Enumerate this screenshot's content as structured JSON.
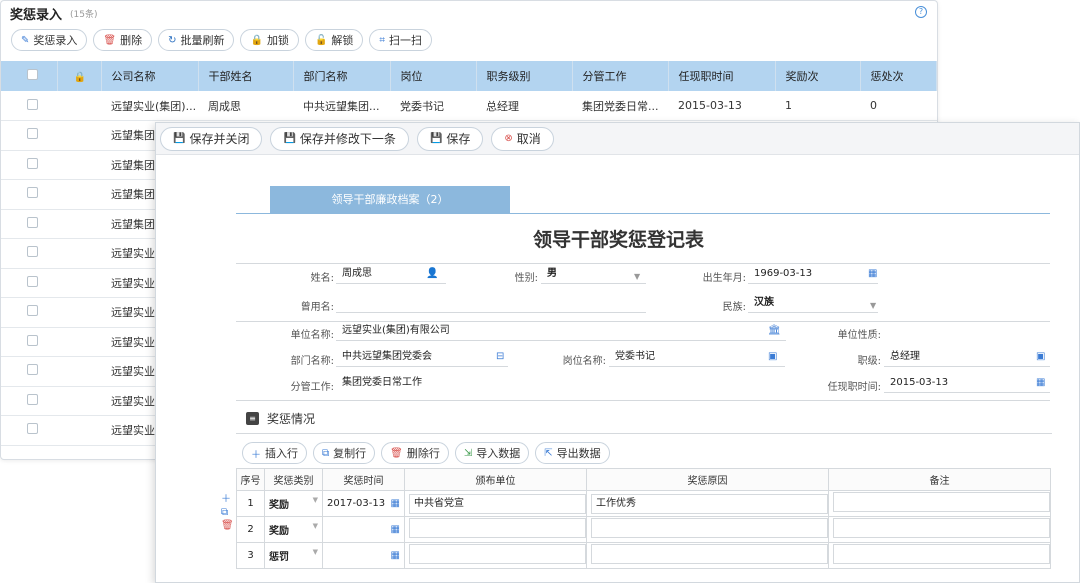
{
  "list_window": {
    "title": "奖惩录入",
    "count": "(15条)",
    "help": "?",
    "toolbar": [
      {
        "label": "奖惩录入",
        "icon": "edit-icon"
      },
      {
        "label": "删除",
        "icon": "trash-icon"
      },
      {
        "label": "批量刷新",
        "icon": "refresh-icon"
      },
      {
        "label": "加锁",
        "icon": "lock-icon"
      },
      {
        "label": "解锁",
        "icon": "unlock-icon"
      },
      {
        "label": "扫一扫",
        "icon": "scan-icon"
      }
    ],
    "columns": [
      "公司名称",
      "干部姓名",
      "部门名称",
      "岗位",
      "职务级别",
      "分管工作",
      "任现职时间",
      "奖励次",
      "惩处次"
    ],
    "first_row": [
      "远望实业(集团)...",
      "周成思",
      "中共远望集团...",
      "党委书记",
      "总经理",
      "集团党委日常...",
      "2015-03-13",
      "1",
      "0"
    ],
    "other_rows": [
      "远望集团财",
      "远望集团财",
      "远望集团财",
      "远望集团财",
      "远望实业(集",
      "远望实业(集",
      "远望实业(集",
      "远望实业(集",
      "远望实业(集",
      "远望实业(集",
      "远望实业(集"
    ]
  },
  "form_window": {
    "toolbar": [
      {
        "label": "保存并关闭",
        "icon": "save-icon"
      },
      {
        "label": "保存并修改下一条",
        "icon": "save-icon"
      },
      {
        "label": "保存",
        "icon": "save-icon"
      },
      {
        "label": "取消",
        "icon": "cancel-icon"
      }
    ],
    "tab": "领导干部廉政档案（2）",
    "title": "领导干部奖惩登记表",
    "fields": {
      "name_label": "姓名:",
      "name": "周成思",
      "gender_label": "性别:",
      "gender": "男",
      "birth_label": "出生年月:",
      "birth": "1969-03-13",
      "alias_label": "曾用名:",
      "alias": "",
      "ethnic_label": "民族:",
      "ethnic": "汉族",
      "unit_label": "单位名称:",
      "unit": "远望实业(集团)有限公司",
      "unit_type_label": "单位性质:",
      "unit_type": "",
      "dept_label": "部门名称:",
      "dept": "中共远望集团党委会",
      "post_label": "岗位名称:",
      "post": "党委书记",
      "rank_label": "职级:",
      "rank": "总经理",
      "duty_label": "分管工作:",
      "duty": "集团党委日常工作",
      "start_label": "任现职时间:",
      "start": "2015-03-13"
    },
    "section": "奖惩情况",
    "detail_toolbar": [
      {
        "label": "插入行",
        "icon": "plus-icon"
      },
      {
        "label": "复制行",
        "icon": "copy-icon"
      },
      {
        "label": "删除行",
        "icon": "trash-icon"
      },
      {
        "label": "导入数据",
        "icon": "import-icon"
      },
      {
        "label": "导出数据",
        "icon": "export-icon"
      }
    ],
    "detail_columns": [
      "序号",
      "奖惩类别",
      "奖惩时间",
      "颁布单位",
      "奖惩原因",
      "备注"
    ],
    "detail_rows": [
      {
        "seq": "1",
        "type": "奖励",
        "date": "2017-03-13",
        "issuer": "中共省党宣",
        "reason": "工作优秀",
        "note": ""
      },
      {
        "seq": "2",
        "type": "奖励",
        "date": "",
        "issuer": "",
        "reason": "",
        "note": ""
      },
      {
        "seq": "3",
        "type": "惩罚",
        "date": "",
        "issuer": "",
        "reason": "",
        "note": ""
      }
    ]
  },
  "colors": {
    "header_blue": "#b3d4f0",
    "tab_blue": "#8cb8dd",
    "accent": "#3a7bd5"
  }
}
